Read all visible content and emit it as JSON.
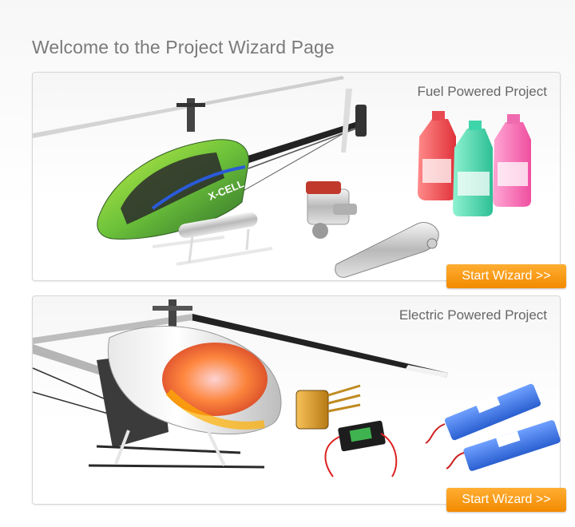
{
  "page": {
    "title": "Welcome to the Project Wizard Page"
  },
  "fuel_panel": {
    "title": "Fuel Powered Project",
    "button_label": "Start Wizard >>",
    "heli_decal": "X-CELL"
  },
  "electric_panel": {
    "title": "Electric Powered Project",
    "button_label": "Start Wizard >>"
  },
  "colors": {
    "accent_orange": "#f28a00",
    "title_gray": "#7a7a7a"
  }
}
